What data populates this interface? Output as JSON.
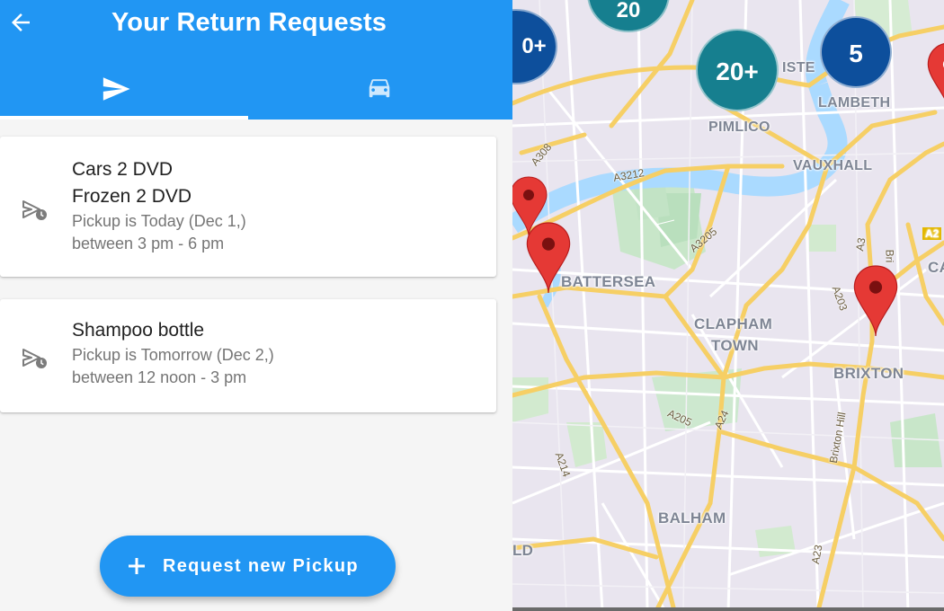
{
  "appbar": {
    "title": "Your Return Requests",
    "tabs": [
      {
        "icon": "send-icon",
        "selected": true
      },
      {
        "icon": "car-icon",
        "selected": false
      }
    ]
  },
  "requests": [
    {
      "items": [
        "Cars 2 DVD",
        "Frozen 2 DVD"
      ],
      "pickup": "Pickup is Today (Dec 1,)",
      "window": "between 3 pm - 6 pm",
      "icon": "scheduled-send-icon"
    },
    {
      "items": [
        "Shampoo bottle"
      ],
      "pickup": "Pickup is Tomorrow (Dec 2,)",
      "window": "between 12 noon - 3 pm",
      "icon": "scheduled-send-icon"
    }
  ],
  "fab": {
    "label": "Request new Pickup",
    "icon": "plus-icon"
  },
  "map": {
    "areas": [
      "PIMLICO",
      "LAMBETH",
      "VAUXHALL",
      "BATTERSEA",
      "CLAPHAM",
      "TOWN",
      "BRIXTON",
      "BALHAM",
      "ISTE",
      "LD",
      "CA",
      "A2"
    ],
    "roads": [
      "A308",
      "A3212",
      "A3205",
      "A3",
      "A203",
      "Brixton Hill",
      "A205",
      "A24",
      "A214",
      "A23",
      "Bri"
    ],
    "clusters": [
      "0+",
      "20+",
      "5",
      "20"
    ],
    "colors": {
      "accent": "#2196f3",
      "cluster_teal": "#167f8f",
      "cluster_navy": "#0d4f9c",
      "pin_red": "#e53935"
    }
  }
}
